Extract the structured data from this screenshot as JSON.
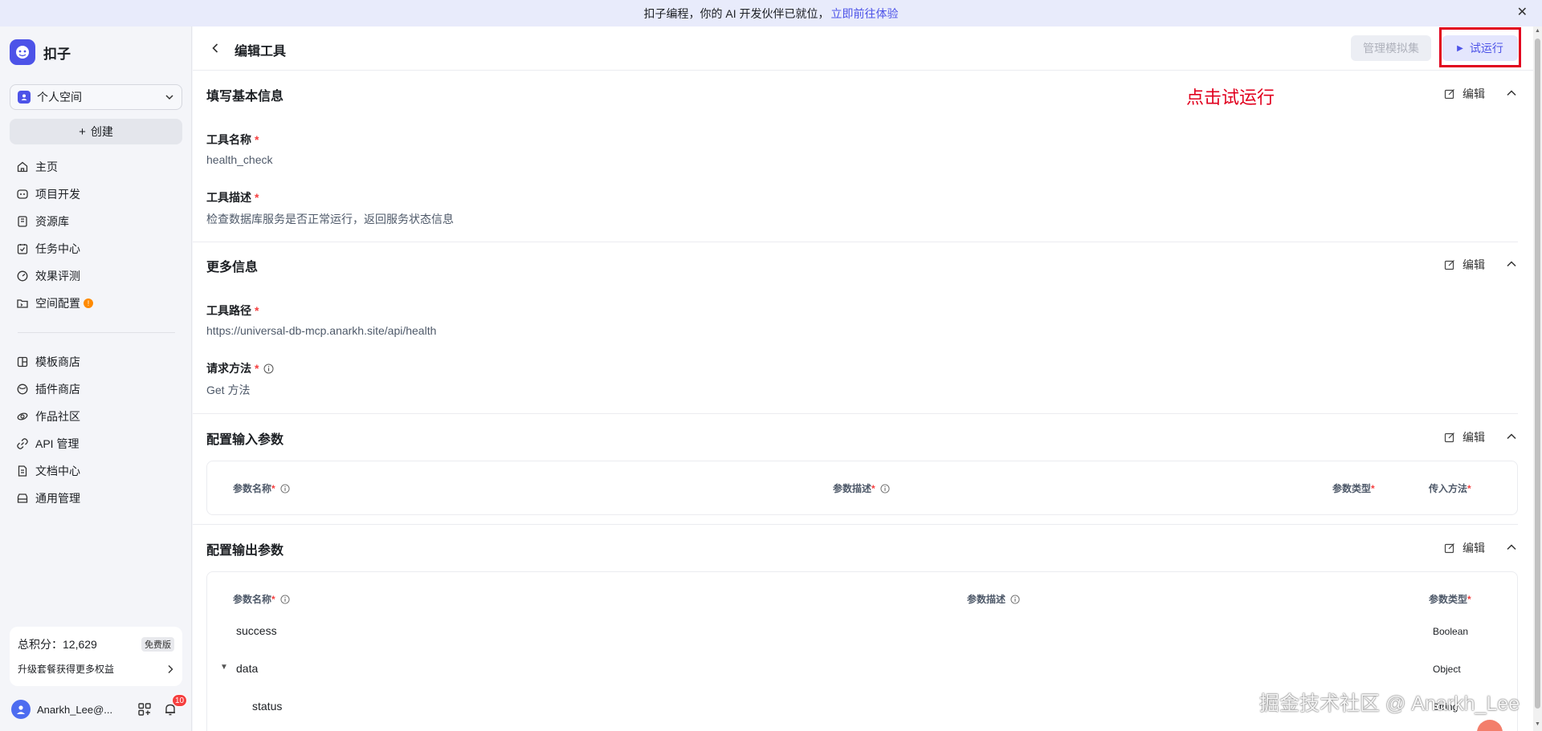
{
  "banner": {
    "text": "扣子编程，你的 AI 开发伙伴已就位，",
    "link": "立即前往体验",
    "close": "✕"
  },
  "sidebar": {
    "brand": "扣子",
    "space": "个人空间",
    "create": "创建",
    "nav_group1": [
      {
        "label": "主页",
        "icon": "home-icon"
      },
      {
        "label": "项目开发",
        "icon": "project-icon"
      },
      {
        "label": "资源库",
        "icon": "library-icon"
      },
      {
        "label": "任务中心",
        "icon": "task-icon"
      },
      {
        "label": "效果评测",
        "icon": "evaluation-icon"
      },
      {
        "label": "空间配置",
        "icon": "settings-folder-icon",
        "dot": "!"
      }
    ],
    "nav_group2": [
      {
        "label": "模板商店",
        "icon": "template-icon"
      },
      {
        "label": "插件商店",
        "icon": "plugin-icon"
      },
      {
        "label": "作品社区",
        "icon": "community-icon"
      },
      {
        "label": "API 管理",
        "icon": "api-icon"
      },
      {
        "label": "文档中心",
        "icon": "docs-icon"
      },
      {
        "label": "通用管理",
        "icon": "manage-icon"
      }
    ],
    "points": {
      "label": "总积分：12,629",
      "badge": "免费版",
      "upgrade": "升级套餐获得更多权益"
    },
    "user": {
      "name": "Anarkh_Lee@...",
      "notifications": "10"
    }
  },
  "header": {
    "title": "编辑工具",
    "mock_button": "管理模拟集",
    "run_button": "试运行",
    "annotation": "点击试运行"
  },
  "sections": {
    "basic": {
      "title": "填写基本信息",
      "edit": "编辑",
      "name_label": "工具名称",
      "name_value": "health_check",
      "desc_label": "工具描述",
      "desc_value": "检查数据库服务是否正常运行，返回服务状态信息"
    },
    "more": {
      "title": "更多信息",
      "edit": "编辑",
      "path_label": "工具路径",
      "path_value": "https://universal-db-mcp.anarkh.site/api/health",
      "method_label": "请求方法",
      "method_value": "Get 方法"
    },
    "input": {
      "title": "配置输入参数",
      "edit": "编辑",
      "headers": [
        "参数名称",
        "参数描述",
        "参数类型",
        "传入方法"
      ]
    },
    "output": {
      "title": "配置输出参数",
      "edit": "编辑",
      "headers": [
        "参数名称",
        "参数描述",
        "参数类型"
      ],
      "rows": [
        {
          "name": "success",
          "type": "Boolean"
        },
        {
          "name": "data",
          "type": "Object"
        },
        {
          "name": "status",
          "type": "String"
        }
      ]
    }
  },
  "required_mark": "*",
  "watermark": "掘金技术社区 @ Anarkh_Lee"
}
